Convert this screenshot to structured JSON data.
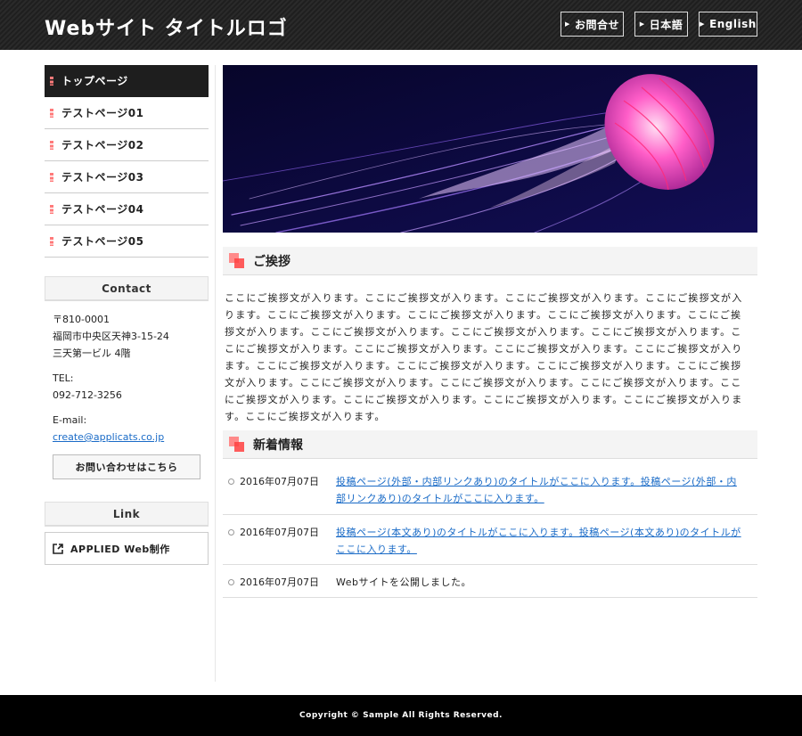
{
  "header": {
    "logo": "Webサイト タイトルロゴ",
    "buttons": [
      {
        "label": "お問合せ"
      },
      {
        "label": "日本語"
      },
      {
        "label": "English"
      }
    ]
  },
  "sidebar": {
    "nav": [
      {
        "label": "トップページ",
        "active": true
      },
      {
        "label": "テストページ01"
      },
      {
        "label": "テストページ02"
      },
      {
        "label": "テストページ03"
      },
      {
        "label": "テストページ04"
      },
      {
        "label": "テストページ05"
      }
    ],
    "contact": {
      "heading": "Contact",
      "postal": "〒810-0001",
      "address1": "福岡市中央区天神3-15-24",
      "address2": "三天第一ビル 4階",
      "tel_label": "TEL:",
      "tel": "092-712-3256",
      "email_label": "E-mail:",
      "email": "create@applicats.co.jp",
      "button": "お問い合わせはこちら"
    },
    "link": {
      "heading": "Link",
      "item": "APPLIED Web制作"
    }
  },
  "main": {
    "greeting": {
      "heading": "ご挨拶",
      "body": "ここにご挨拶文が入ります。ここにご挨拶文が入ります。ここにご挨拶文が入ります。ここにご挨拶文が入ります。ここにご挨拶文が入ります。ここにご挨拶文が入ります。ここにご挨拶文が入ります。ここにご挨拶文が入ります。ここにご挨拶文が入ります。ここにご挨拶文が入ります。ここにご挨拶文が入ります。ここにご挨拶文が入ります。ここにご挨拶文が入ります。ここにご挨拶文が入ります。ここにご挨拶文が入ります。ここにご挨拶文が入ります。ここにご挨拶文が入ります。ここにご挨拶文が入ります。ここにご挨拶文が入ります。ここにご挨拶文が入ります。ここにご挨拶文が入ります。ここにご挨拶文が入ります。ここにご挨拶文が入ります。ここにご挨拶文が入ります。ここにご挨拶文が入ります。ここにご挨拶文が入ります。ここにご挨拶文が入ります。"
    },
    "news": {
      "heading": "新着情報",
      "items": [
        {
          "date": "2016年07月07日",
          "title": "投稿ページ(外部・内部リンクあり)のタイトルがここに入ります。投稿ページ(外部・内部リンクあり)のタイトルがここに入ります。",
          "link": true
        },
        {
          "date": "2016年07月07日",
          "title": "投稿ページ(本文あり)のタイトルがここに入ります。投稿ページ(本文あり)のタイトルがここに入ります。",
          "link": true
        },
        {
          "date": "2016年07月07日",
          "title": "Webサイトを公開しました。",
          "link": false
        }
      ]
    }
  },
  "footer": {
    "copyright": "Copyright © Sample All Rights Reserved."
  }
}
